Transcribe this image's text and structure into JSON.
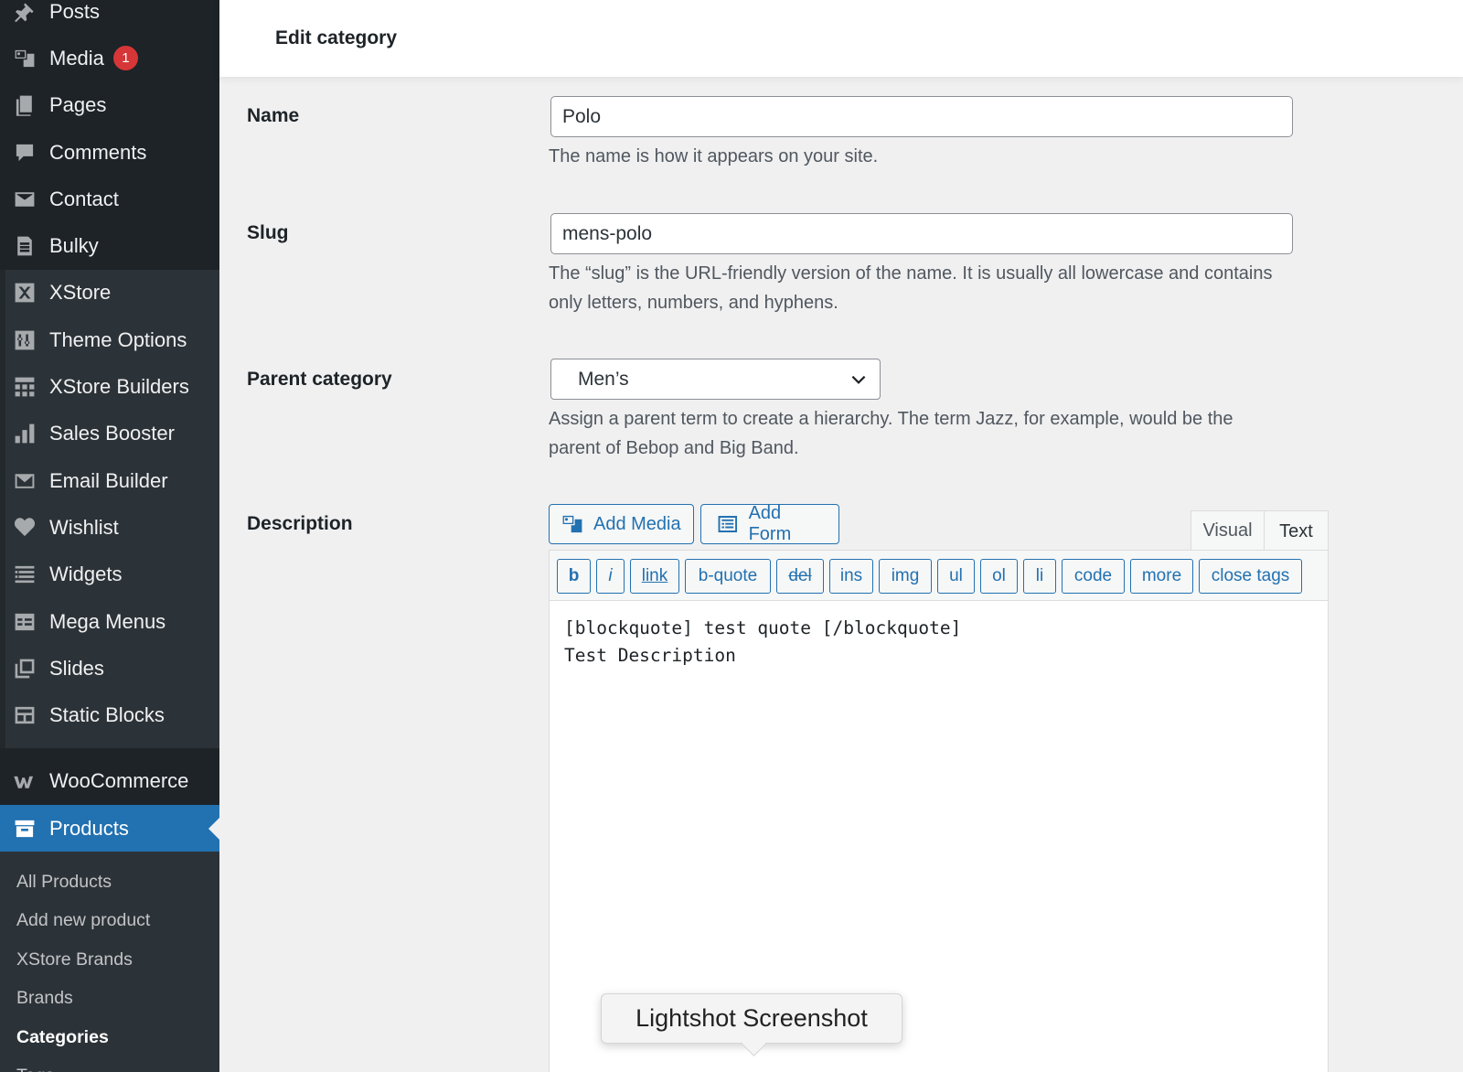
{
  "sidebar": {
    "group1": [
      {
        "label": "Posts",
        "icon": "pin-icon"
      },
      {
        "label": "Media",
        "icon": "media-icon",
        "badge": "1"
      },
      {
        "label": "Pages",
        "icon": "pages-icon"
      },
      {
        "label": "Comments",
        "icon": "comment-icon"
      },
      {
        "label": "Contact",
        "icon": "mail-icon"
      },
      {
        "label": "Bulky",
        "icon": "spreadsheet-icon"
      }
    ],
    "group2": [
      {
        "label": "XStore",
        "icon": "xstore-icon"
      },
      {
        "label": "Theme Options",
        "icon": "sliders-icon"
      },
      {
        "label": "XStore Builders",
        "icon": "grid-icon"
      },
      {
        "label": "Sales Booster",
        "icon": "bar-chart-icon"
      },
      {
        "label": "Email Builder",
        "icon": "envelope-icon"
      },
      {
        "label": "Wishlist",
        "icon": "heart-icon"
      },
      {
        "label": "Widgets",
        "icon": "widgets-icon"
      },
      {
        "label": "Mega Menus",
        "icon": "table-icon"
      },
      {
        "label": "Slides",
        "icon": "slides-icon"
      },
      {
        "label": "Static Blocks",
        "icon": "blocks-icon"
      }
    ],
    "group3": [
      {
        "label": "WooCommerce",
        "icon": "woo-icon"
      },
      {
        "label": "Products",
        "icon": "archive-icon",
        "active": true
      }
    ],
    "submenu": [
      "All Products",
      "Add new product",
      "XStore Brands",
      "Brands",
      "Categories",
      "Tags"
    ],
    "current_sub": "Categories"
  },
  "header": {
    "title": "Edit category"
  },
  "form": {
    "name_label": "Name",
    "name_value": "Polo",
    "name_help": "The name is how it appears on your site.",
    "slug_label": "Slug",
    "slug_value": "mens-polo",
    "slug_help": "The “slug” is the URL-friendly version of the name. It is usually all lowercase and contains only letters, numbers, and hyphens.",
    "parent_label": "Parent category",
    "parent_value": "Men’s",
    "parent_help": "Assign a parent term to create a hierarchy. The term Jazz, for example, would be the parent of Bebop and Big Band.",
    "description_label": "Description"
  },
  "editor": {
    "add_media": "Add Media",
    "add_form": "Add Form",
    "tab_visual": "Visual",
    "tab_text": "Text",
    "quicktags": [
      "b",
      "i",
      "link",
      "b-quote",
      "del",
      "ins",
      "img",
      "ul",
      "ol",
      "li",
      "code",
      "more",
      "close tags"
    ],
    "content_line1": "[blockquote] test quote [/blockquote]",
    "content_line2": "Test Description"
  },
  "tooltip": {
    "text": "Lightshot Screenshot"
  },
  "colors": {
    "sidebar": "#1d2327",
    "accent": "#2271b1",
    "badge": "#d63638"
  }
}
